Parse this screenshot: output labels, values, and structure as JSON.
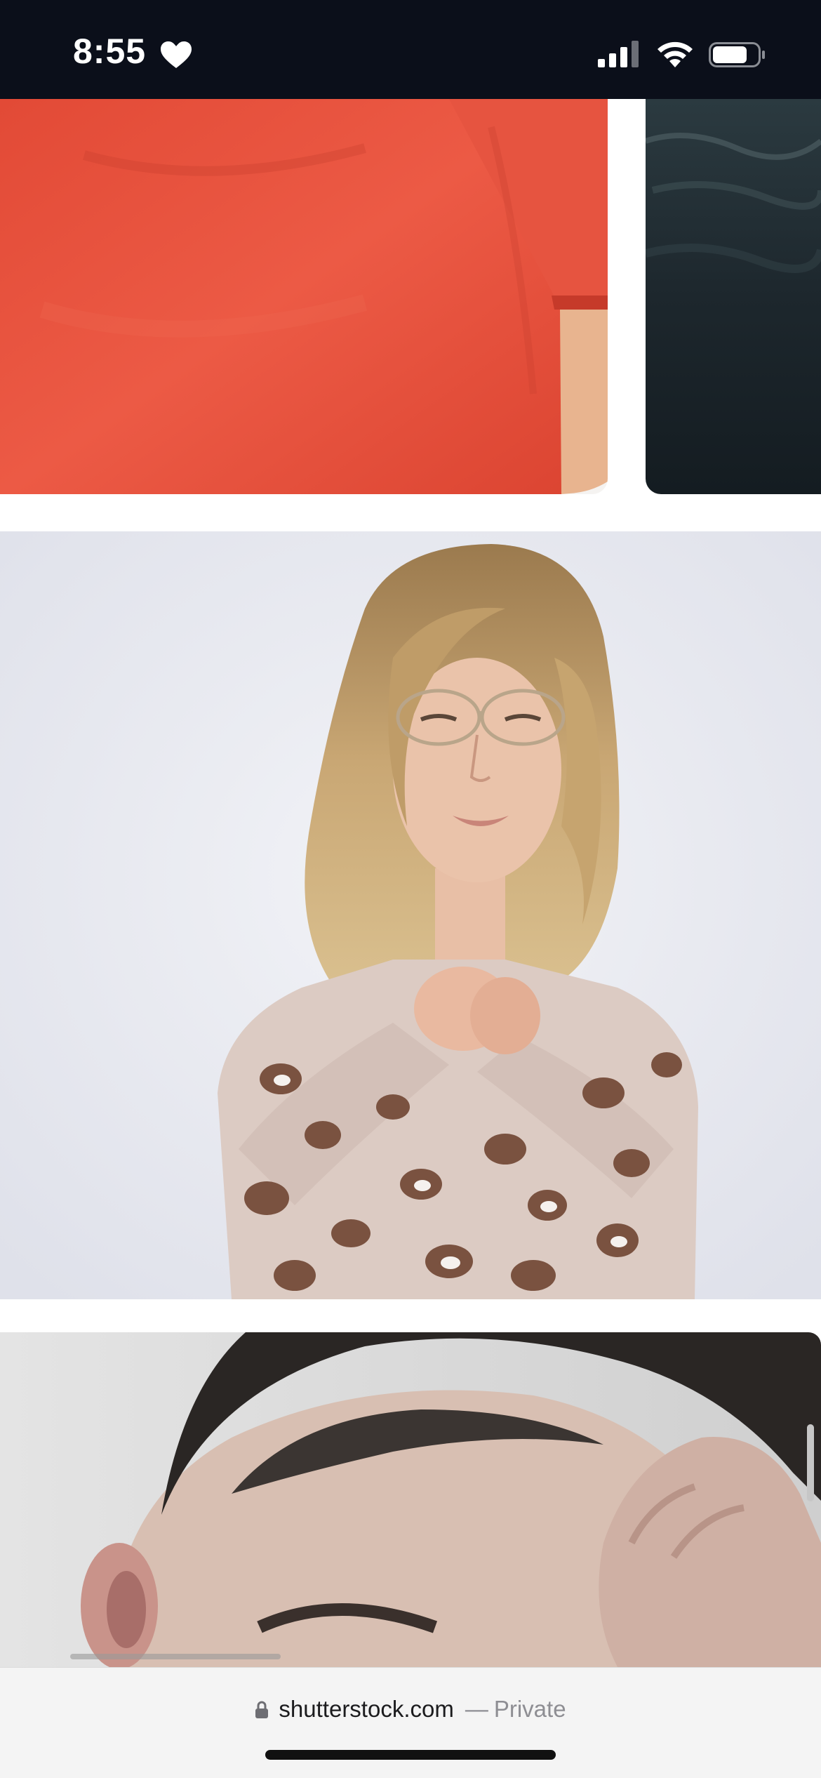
{
  "status_bar": {
    "time": "8:55",
    "status_icon": "heart-icon",
    "icons": [
      "cellular-signal-icon",
      "wifi-icon",
      "battery-icon"
    ]
  },
  "results": [
    {
      "name": "red shirt photo",
      "dominant_color": "#e8533f"
    },
    {
      "name": "dark water photo",
      "dominant_color": "#1f2a31"
    },
    {
      "name": "girl in leopard sweater photo",
      "dominant_color": "#e9eaf0"
    },
    {
      "name": "boy holding head photo",
      "dominant_color": "#cfcfcf"
    }
  ],
  "browser": {
    "domain": "shutterstock.com",
    "separator": "—",
    "mode": "Private",
    "lock_icon": "lock-icon"
  }
}
